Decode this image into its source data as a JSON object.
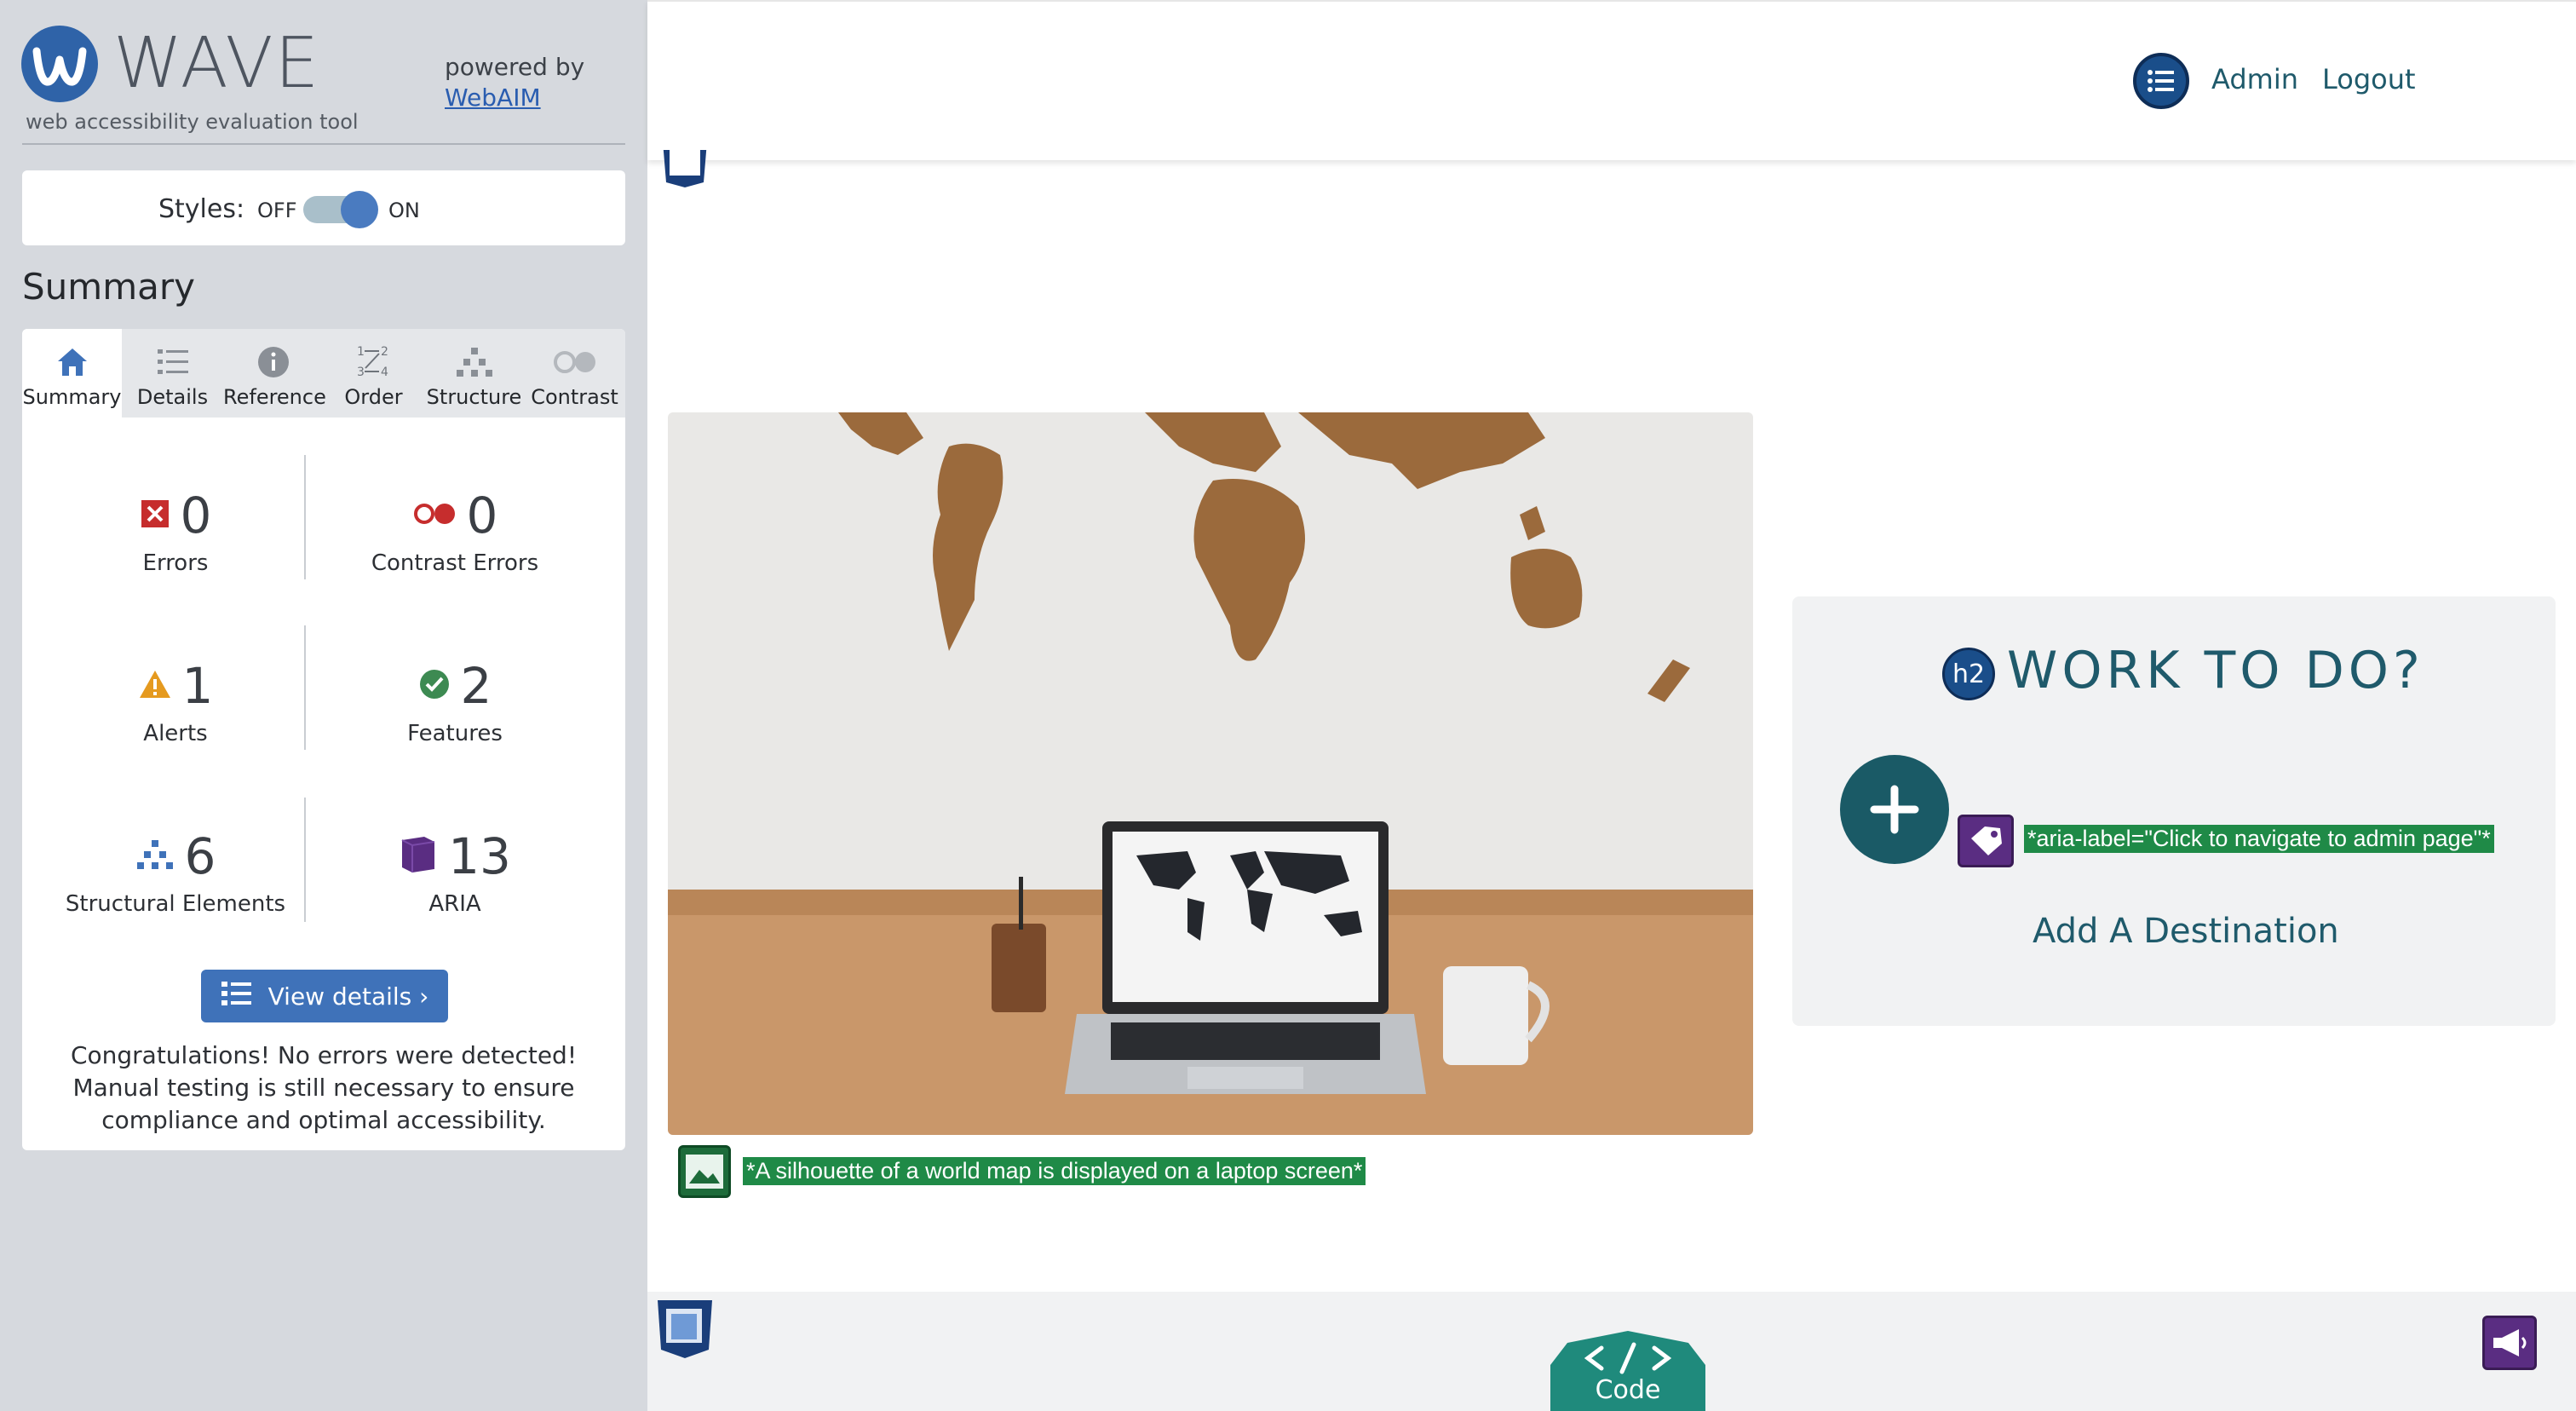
{
  "sidebar": {
    "brand": "WAVE",
    "tagline": "web accessibility evaluation tool",
    "powered_by": "powered by",
    "webaim_link": "WebAIM",
    "styles": {
      "label": "Styles:",
      "off": "OFF",
      "on": "ON",
      "enabled": true
    },
    "summary_heading": "Summary",
    "tabs": [
      {
        "label": "Summary",
        "icon": "home-icon",
        "active": true
      },
      {
        "label": "Details",
        "icon": "list-icon"
      },
      {
        "label": "Reference",
        "icon": "info-icon"
      },
      {
        "label": "Order",
        "icon": "order-icon"
      },
      {
        "label": "Structure",
        "icon": "structure-icon"
      },
      {
        "label": "Contrast",
        "icon": "contrast-icon"
      }
    ],
    "stats": {
      "errors": {
        "count": "0",
        "label": "Errors"
      },
      "contrast_errors": {
        "count": "0",
        "label": "Contrast Errors"
      },
      "alerts": {
        "count": "1",
        "label": "Alerts"
      },
      "features": {
        "count": "2",
        "label": "Features"
      },
      "structural": {
        "count": "6",
        "label": "Structural Elements"
      },
      "aria": {
        "count": "13",
        "label": "ARIA"
      }
    },
    "view_details": "View details ›",
    "congrats": "Congratulations! No errors were detected! Manual testing is still necessary to ensure compliance and optimal accessibility."
  },
  "topbar": {
    "admin": "Admin",
    "logout": "Logout"
  },
  "main": {
    "image_alt_label": "*A silhouette of a world map is displayed on a laptop screen*",
    "work_title": "WORK TO DO?",
    "h2_badge": "h2",
    "aria_label_text": "*aria-label=\"Click to navigate to admin page\"*",
    "add_destination": "Add A Destination",
    "code_label": "Code"
  },
  "colors": {
    "sidebar_bg": "#d6d9de",
    "accent_blue": "#3f72b9",
    "teal_text": "#1f5a6b",
    "wave_green": "#1f8a47",
    "aria_purple": "#5a2d82"
  }
}
